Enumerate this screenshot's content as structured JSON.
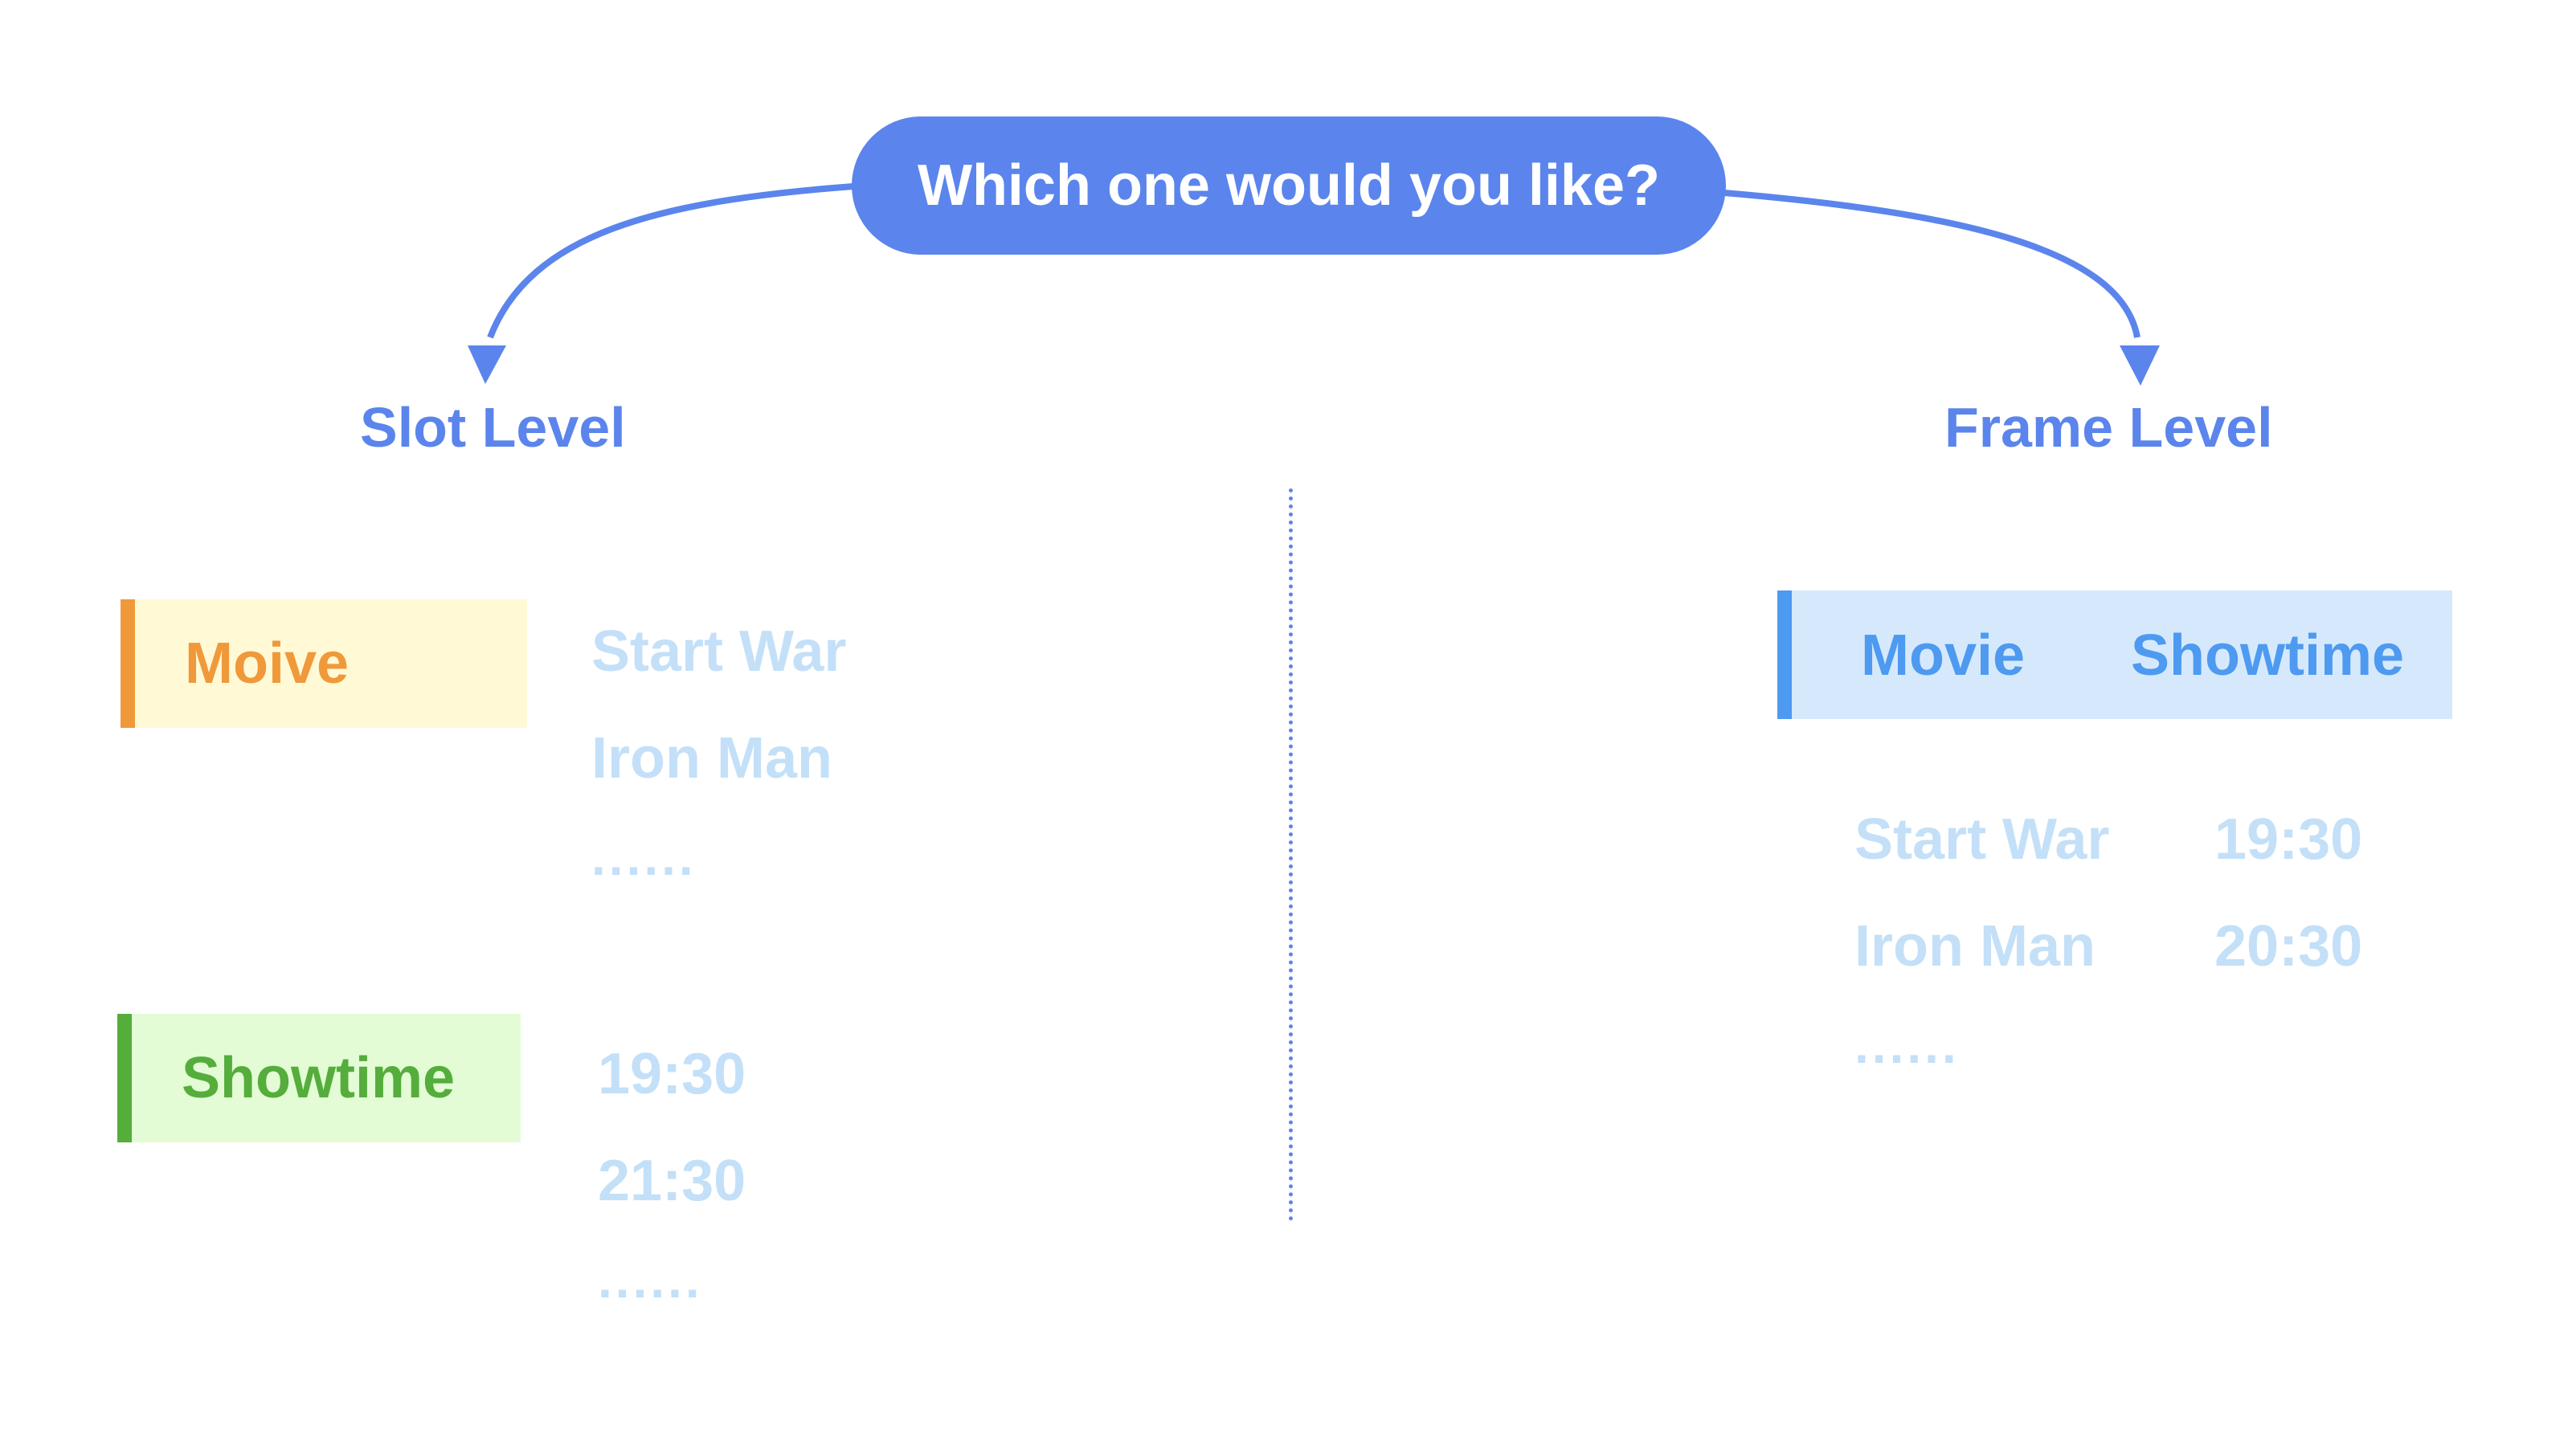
{
  "question": "Which one would you like?",
  "slot_level": {
    "title": "Slot Level",
    "slots": [
      {
        "name": "Moive",
        "values": [
          "Start War",
          "Iron Man"
        ],
        "more": "......"
      },
      {
        "name": "Showtime",
        "values": [
          "19:30",
          "21:30"
        ],
        "more": "......"
      }
    ]
  },
  "frame_level": {
    "title": "Frame Level",
    "headers": [
      "Movie",
      "Showtime"
    ],
    "rows": [
      [
        "Start War",
        "19:30"
      ],
      [
        "Iron Man",
        "20:30"
      ]
    ],
    "more": "......"
  },
  "colors": {
    "accent_blue": "#5b85ec",
    "movie_orange": "#f0993a",
    "showtime_green": "#55ad3b",
    "frame_blue": "#4d9af0",
    "value_light_blue": "#c3e0f8"
  }
}
